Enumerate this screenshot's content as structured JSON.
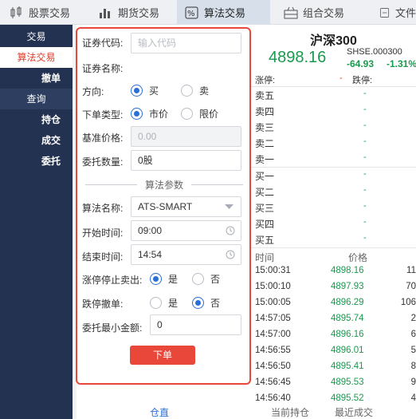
{
  "top_tabs": [
    {
      "label": "股票交易",
      "icon": "candlestick-icon"
    },
    {
      "label": "期货交易",
      "icon": "bar-chart-icon"
    },
    {
      "label": "算法交易",
      "icon": "percent-icon"
    },
    {
      "label": "组合交易",
      "icon": "basket-icon"
    },
    {
      "label": "文件",
      "icon": "file-icon"
    }
  ],
  "sidebar": {
    "trade_head": "交易",
    "algo": "算法交易",
    "cancel": "撤单",
    "query_head": "查询",
    "position": "持仓",
    "deals": "成交",
    "orders": "委托"
  },
  "form": {
    "code_label": "证券代码:",
    "code_placeholder": "输入代码",
    "name_label": "证券名称:",
    "dir_label": "方向:",
    "buy": "买",
    "sell": "卖",
    "type_label": "下单类型:",
    "market": "市价",
    "limit": "限价",
    "base_label": "基准价格:",
    "base_value": "0.00",
    "qty_label": "委托数量:",
    "qty_value": "0股",
    "section": "算法参数",
    "algo_label": "算法名称:",
    "algo_value": "ATS-SMART",
    "start_label": "开始时间:",
    "start_value": "09:00",
    "end_label": "结束时间:",
    "end_value": "14:54",
    "zt_label": "涨停停止卖出:",
    "yes": "是",
    "no": "否",
    "dt_label": "跌停撤单:",
    "min_label": "委托最小金额:",
    "min_value": "0",
    "submit": "下单"
  },
  "market": {
    "title": "沪深300",
    "price": "4898.16",
    "code": "SHSE.000300",
    "change": "-64.93",
    "pct": "-1.31%",
    "zt": "涨停:",
    "zt_v": "-",
    "dt": "跌停:",
    "asks": [
      "卖五",
      "卖四",
      "卖三",
      "卖二",
      "卖一"
    ],
    "bids": [
      "买一",
      "买二",
      "买三",
      "买四",
      "买五"
    ],
    "dash": "-",
    "col_time": "时间",
    "col_price": "价格",
    "ticks": [
      {
        "t": "15:00:31",
        "p": "4898.16",
        "v": "11"
      },
      {
        "t": "15:00:10",
        "p": "4897.93",
        "v": "70"
      },
      {
        "t": "15:00:05",
        "p": "4896.29",
        "v": "106"
      },
      {
        "t": "14:57:05",
        "p": "4895.74",
        "v": "2"
      },
      {
        "t": "14:57:00",
        "p": "4896.16",
        "v": "6"
      },
      {
        "t": "14:56:55",
        "p": "4896.01",
        "v": "5"
      },
      {
        "t": "14:56:50",
        "p": "4895.41",
        "v": "8"
      },
      {
        "t": "14:56:45",
        "p": "4895.53",
        "v": "9"
      },
      {
        "t": "14:56:40",
        "p": "4895.52",
        "v": "4"
      }
    ],
    "accent_green": "#1a9a4e"
  },
  "bottom": {
    "left": "仓直",
    "mid": "当前持仓",
    "right": "最近成交"
  }
}
